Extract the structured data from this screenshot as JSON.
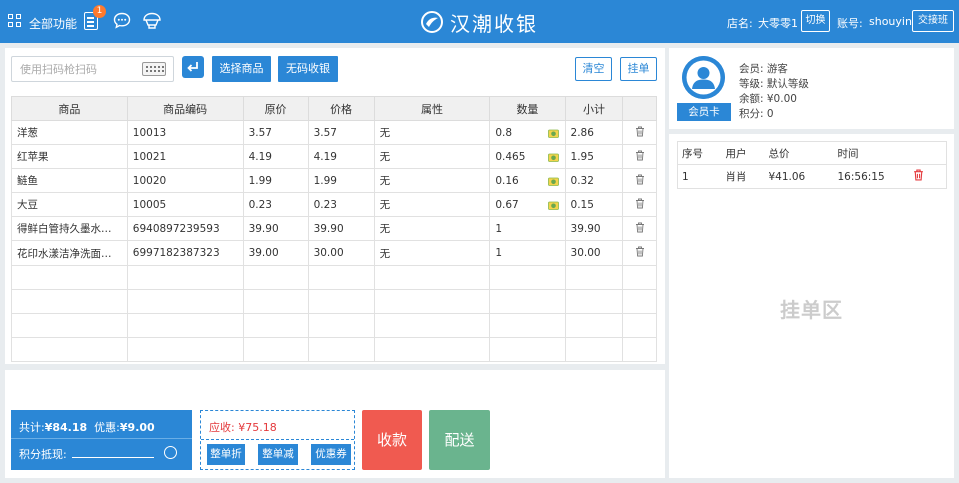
{
  "topbar": {
    "all_functions": "全部功能",
    "notification_count": "1",
    "brand": "汉潮收银",
    "store_label": "店名:",
    "store_name": "大零零1",
    "switch_label": "切换",
    "account_label": "账号:",
    "account_name": "shouyin",
    "shift_label": "交接班"
  },
  "toolbar": {
    "scan_placeholder": "使用扫码枪扫码",
    "select_goods": "选择商品",
    "no_code_checkout": "无码收银",
    "clear": "清空",
    "hold_order": "挂单"
  },
  "cart": {
    "headers": [
      "商品",
      "商品编码",
      "原价",
      "价格",
      "属性",
      "数量",
      "小计",
      ""
    ],
    "rows": [
      {
        "name": "洋葱",
        "code": "10013",
        "orig": "3.57",
        "price": "3.57",
        "attr": "无",
        "qty": "0.8",
        "subtotal": "2.86",
        "weighed": true
      },
      {
        "name": "红苹果",
        "code": "10021",
        "orig": "4.19",
        "price": "4.19",
        "attr": "无",
        "qty": "0.465",
        "subtotal": "1.95",
        "weighed": true
      },
      {
        "name": "鲢鱼",
        "code": "10020",
        "orig": "1.99",
        "price": "1.99",
        "attr": "无",
        "qty": "0.16",
        "subtotal": "0.32",
        "weighed": true
      },
      {
        "name": "大豆",
        "code": "10005",
        "orig": "0.23",
        "price": "0.23",
        "attr": "无",
        "qty": "0.67",
        "subtotal": "0.15",
        "weighed": true
      },
      {
        "name": "得鲜白管持久墨水唇釉",
        "code": "6940897239593",
        "orig": "39.90",
        "price": "39.90",
        "attr": "无",
        "qty": "1",
        "subtotal": "39.90",
        "weighed": false
      },
      {
        "name": "花印水漾洁净洗面乳组合",
        "code": "6997182387323",
        "orig": "39.00",
        "price": "30.00",
        "attr": "无",
        "qty": "1",
        "subtotal": "30.00",
        "weighed": false
      }
    ],
    "empty_rows": 4
  },
  "summary": {
    "total_label": "共计:",
    "total": "¥84.18",
    "discount_label": "优惠:",
    "discount": "¥9.00",
    "points_label": "积分抵现:",
    "receivable_label": "应收:",
    "receivable": "¥75.18",
    "whole_discount": "整单折",
    "whole_reduce": "整单减",
    "coupon": "优惠券",
    "pay": "收款",
    "deliver": "配送"
  },
  "member": {
    "card_button": "会员卡",
    "member_line": "会员:   游客",
    "level_line": "等级:   默认等级",
    "balance_line": "余额:   ¥0.00",
    "points_line": "积分:   0"
  },
  "hold": {
    "headers": [
      "序号",
      "用户",
      "总价",
      "时间",
      ""
    ],
    "rows": [
      {
        "no": "1",
        "user": "肖肖",
        "total": "¥41.06",
        "time": "16:56:15"
      }
    ],
    "area_title": "挂单区"
  },
  "colors": {
    "primary": "#2b87d6",
    "pay": "#f05a50",
    "deliver": "#6ab48e",
    "receivable": "#e4393c"
  }
}
